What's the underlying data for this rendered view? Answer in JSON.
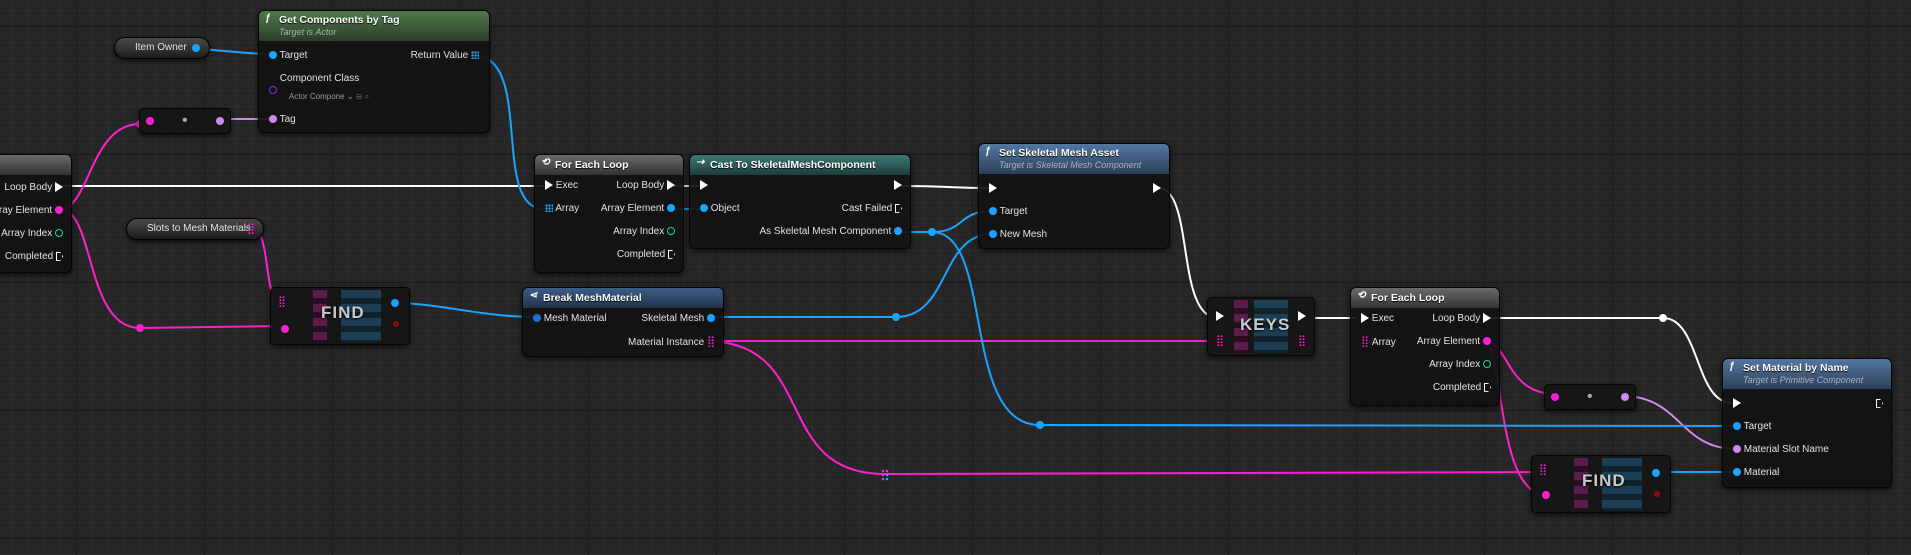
{
  "colors": {
    "exec": "#ffffff",
    "object": "#1ba3ff",
    "name": "#d088f2",
    "map": "#ff1fcf",
    "integer": "#19d6a0",
    "function_header": "#4f7a4a"
  },
  "nodes": {
    "loop_partial": {
      "loop_body": "Loop Body",
      "array_element": "Array Element",
      "array_index": "Array Index",
      "completed": "Completed"
    },
    "item_owner": {
      "label": "Item Owner"
    },
    "get_components": {
      "title": "Get Components by Tag",
      "subtitle": "Target is Actor",
      "target": "Target",
      "return_value": "Return Value",
      "component_class": "Component Class",
      "class_value": "Actor Compone",
      "tag": "Tag"
    },
    "slots_var": {
      "label": "Slots to Mesh Materials"
    },
    "find1": {
      "label": "FIND"
    },
    "for_each_1": {
      "title": "For Each Loop",
      "exec": "Exec",
      "array": "Array",
      "loop_body": "Loop Body",
      "array_element": "Array Element",
      "array_index": "Array Index",
      "completed": "Completed"
    },
    "cast": {
      "title": "Cast To SkeletalMeshComponent",
      "object": "Object",
      "cast_failed": "Cast Failed",
      "as_component": "As Skeletal Mesh Component"
    },
    "set_mesh": {
      "title": "Set Skeletal Mesh Asset",
      "subtitle": "Target is Skeletal Mesh Component",
      "target": "Target",
      "new_mesh": "New Mesh"
    },
    "break_mat": {
      "title": "Break MeshMaterial",
      "mesh_material": "Mesh Material",
      "skeletal_mesh": "Skeletal Mesh",
      "material_instance": "Material Instance"
    },
    "keys": {
      "label": "KEYS"
    },
    "for_each_2": {
      "title": "For Each Loop",
      "exec": "Exec",
      "array": "Array",
      "loop_body": "Loop Body",
      "array_element": "Array Element",
      "array_index": "Array Index",
      "completed": "Completed"
    },
    "find2": {
      "label": "FIND"
    },
    "set_material": {
      "title": "Set Material by Name",
      "subtitle": "Target is Primitive Component",
      "target": "Target",
      "slot_name": "Material Slot Name",
      "material": "Material"
    }
  }
}
